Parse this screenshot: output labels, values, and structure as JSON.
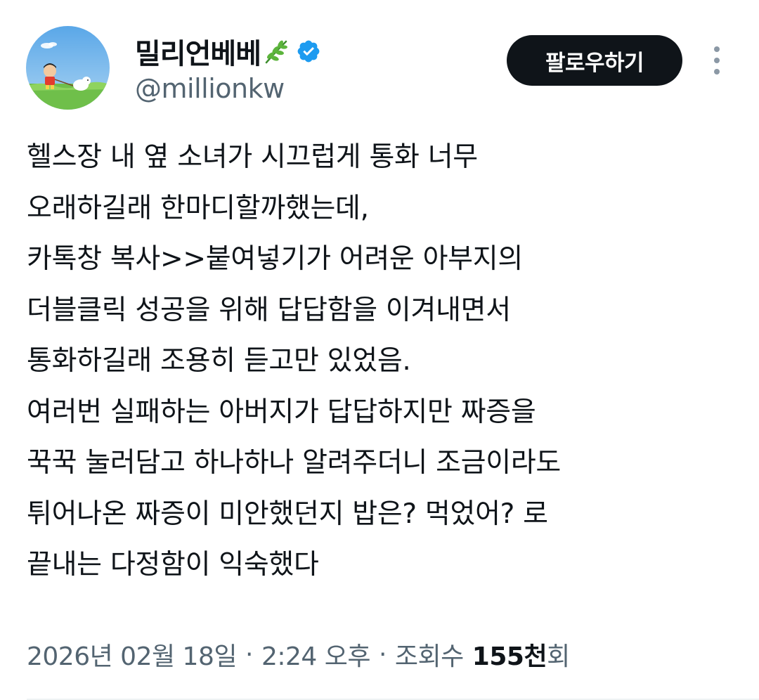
{
  "user": {
    "display_name": "밀리언베베",
    "handle": "@millionkw",
    "name_emoji": "herb-emoji",
    "verified": true,
    "verified_color": "#1d9bf0"
  },
  "header": {
    "follow_label": "팔로우하기",
    "more_icon": "more-vertical-icon"
  },
  "tweet": {
    "lines": [
      "헬스장 내 옆 소녀가 시끄럽게 통화 너무",
      "오래하길래 한마디할까했는데,",
      "카톡창 복사>>붙여넣기가 어려운 아부지의",
      "더블클릭 성공을 위해 답답함을 이겨내면서",
      "통화하길래 조용히 듣고만 있었음.",
      "여러번 실패하는 아버지가 답답하지만 짜증을",
      "꾹꾹 눌러담고 하나하나 알려주더니 조금이라도",
      "튀어나온 짜증이 미안했던지 밥은? 먹었어? 로",
      "끝내는 다정함이 익숙했다"
    ]
  },
  "meta": {
    "date": "2026년 02월 18일",
    "separator": "·",
    "time": "2:24 오후",
    "views_label": "조회수",
    "views_count": "155천",
    "views_suffix": "회"
  },
  "colors": {
    "text_primary": "#0f1419",
    "text_secondary": "#536471",
    "button_bg": "#0f1419",
    "verified": "#1d9bf0"
  }
}
